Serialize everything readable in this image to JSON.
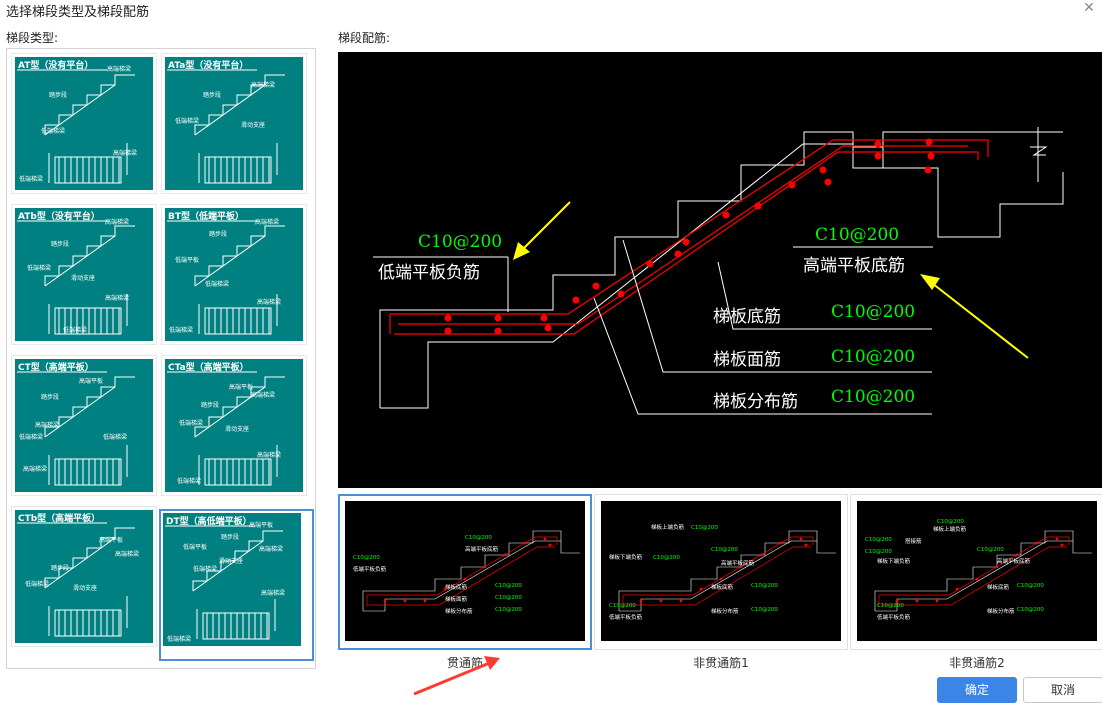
{
  "dialog": {
    "title": "选择梯段类型及梯段配筋",
    "close_icon": "close-icon"
  },
  "left": {
    "label": "梯段类型:",
    "items": [
      {
        "title": "AT型（没有平台）",
        "labels": [
          "高端梯梁",
          "踏步段",
          "低端梯梁",
          "高端梯梁",
          "低端梯梁"
        ]
      },
      {
        "title": "ATa型（没有平台）",
        "labels": [
          "高端梯梁",
          "踏步段",
          "低端梯梁",
          "滑动支座"
        ]
      },
      {
        "title": "ATb型（没有平台）",
        "labels": [
          "高端梯梁",
          "踏步段",
          "低端梯梁",
          "滑动支座",
          "高端梯梁",
          "低端梯梁"
        ]
      },
      {
        "title": "BT型（低端平板）",
        "labels": [
          "高端梯梁",
          "踏步段",
          "低端平板",
          "低端梯梁",
          "高端梯梁",
          "低端梯梁"
        ]
      },
      {
        "title": "CT型（高端平板）",
        "labels": [
          "高端平板",
          "踏步段",
          "高端梯梁",
          "低端梯梁",
          "高端梯梁",
          "低端梯梁"
        ]
      },
      {
        "title": "CTa型（高端平板）",
        "labels": [
          "高端平板",
          "高端梯梁",
          "踏步段",
          "低端梯梁",
          "滑动支座",
          "高端梯梁",
          "低端梯梁"
        ]
      },
      {
        "title": "CTb型（高端平板）",
        "labels": [
          "高端平板",
          "高端梯梁",
          "踏步段",
          "低端梯梁",
          "滑动支座"
        ]
      },
      {
        "title": "DT型（高低端平板）",
        "labels": [
          "高端平板",
          "踏步段",
          "低端平板",
          "滑动支座",
          "低端梯梁",
          "高端梯梁",
          "高端梯梁",
          "低端梯梁"
        ]
      }
    ]
  },
  "right": {
    "label": "梯段配筋:",
    "preview": {
      "left_annot": {
        "spec": "C10@200",
        "text": "低端平板负筋"
      },
      "right_annot": {
        "spec": "C10@200",
        "text": "高端平板底筋"
      },
      "rows": [
        {
          "text": "梯板底筋",
          "spec": "C10@200"
        },
        {
          "text": "梯板面筋",
          "spec": "C10@200"
        },
        {
          "text": "梯板分布筋",
          "spec": "C10@200"
        }
      ]
    },
    "options": [
      {
        "label": "贯通筋",
        "selected": true,
        "texts": [
          "C10@200",
          "低端平板负筋",
          "C10@200",
          "高端平板底筋",
          "梯板底筋",
          "C10@200",
          "梯板面筋",
          "C10@200",
          "梯板分布筋",
          "C10@200"
        ]
      },
      {
        "label": "非贯通筋1",
        "selected": false,
        "texts": [
          "梯板上端负筋",
          "C10@200",
          "梯板下端负筋",
          "C10@200",
          "C10@200",
          "高端平板底筋",
          "梯板底筋",
          "C10@200",
          "梯板分布筋",
          "C10@200",
          "C10@200",
          "低端平板负筋"
        ]
      },
      {
        "label": "非贯通筋2",
        "selected": false,
        "texts": [
          "C10@200",
          "梯板上端负筋",
          "C10@200",
          "搭接筋",
          "C10@200",
          "梯板下端负筋",
          "C10@200",
          "高端平板底筋",
          "梯板底筋",
          "C10@200",
          "梯板分布筋",
          "C10@200",
          "C10@200",
          "低端平板负筋"
        ]
      }
    ]
  },
  "buttons": {
    "ok": "确定",
    "cancel": "取消"
  },
  "colors": {
    "thumb_bg": "#008080",
    "accent": "#3c84e6",
    "selected_border": "#4a90d9",
    "rebar": "#ff0000",
    "spec_text": "#00ff00",
    "annotation_arrow": "#ffff00",
    "red_arrow": "#ff3b30"
  }
}
